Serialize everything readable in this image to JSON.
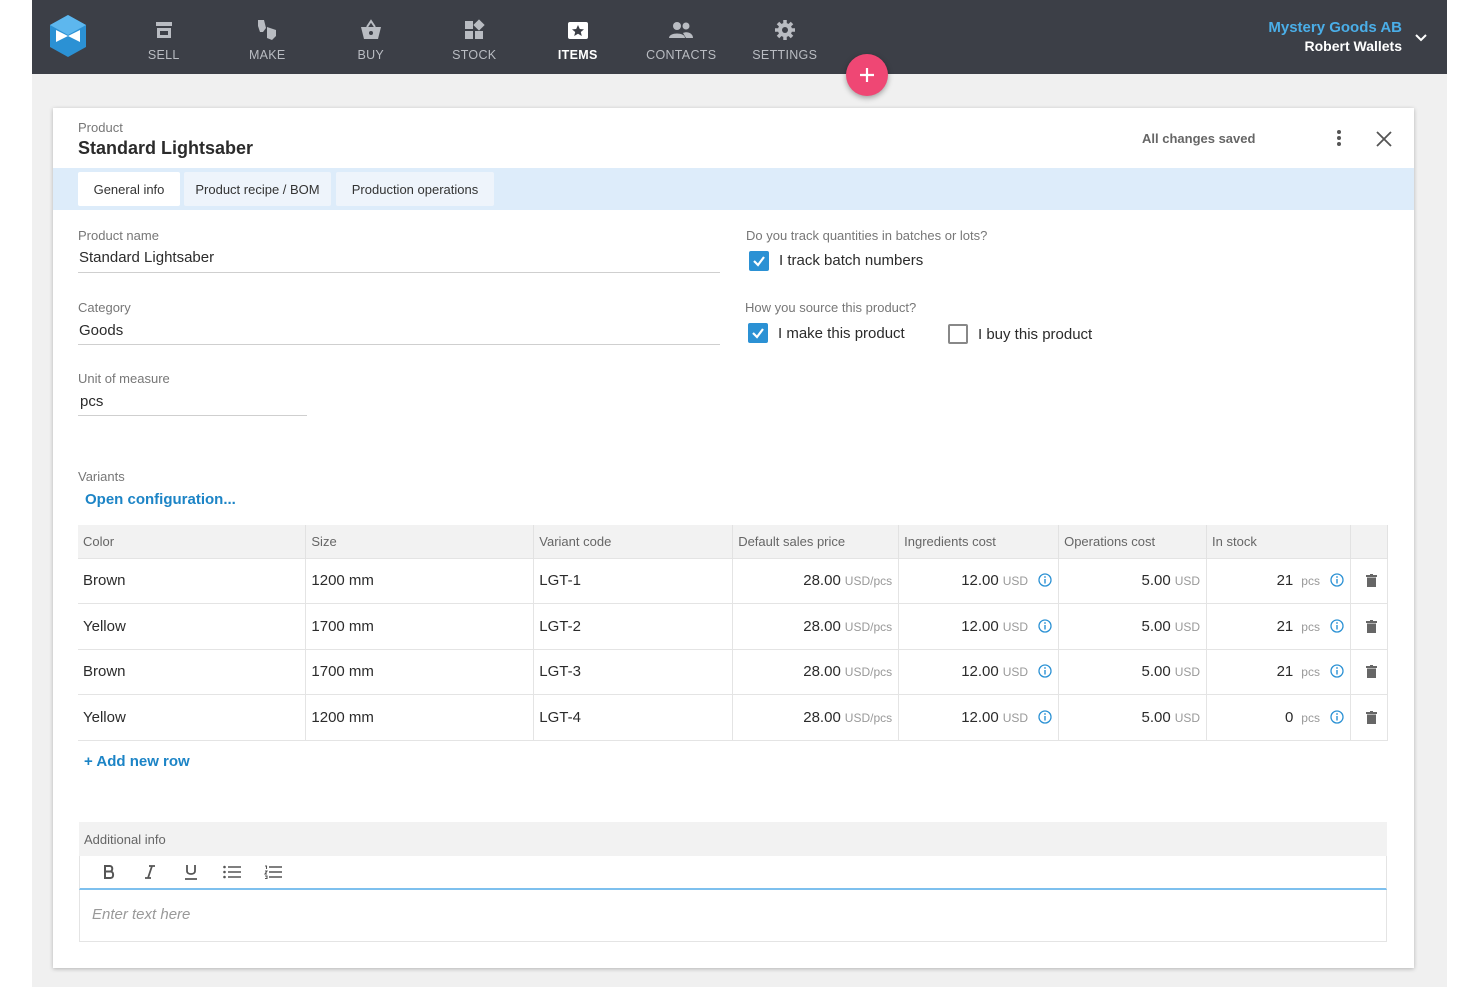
{
  "colors": {
    "topbar": "#3c3f47",
    "accent_blue": "#2b91d4",
    "company_name": "#4aaee8",
    "fab": "#ef4774",
    "tab_bar": "#ddecfa"
  },
  "nav": {
    "items": [
      {
        "label": "SELL",
        "icon": "store-icon"
      },
      {
        "label": "MAKE",
        "icon": "make-icon"
      },
      {
        "label": "BUY",
        "icon": "basket-icon"
      },
      {
        "label": "STOCK",
        "icon": "stock-icon"
      },
      {
        "label": "ITEMS",
        "icon": "items-icon",
        "active": true
      },
      {
        "label": "CONTACTS",
        "icon": "contacts-icon"
      },
      {
        "label": "SETTINGS",
        "icon": "gear-icon"
      }
    ],
    "company": "Mystery Goods AB",
    "user": "Robert Wallets"
  },
  "card": {
    "crumb": "Product",
    "title": "Standard Lightsaber",
    "status": "All changes saved"
  },
  "tabs": [
    "General info",
    "Product recipe / BOM",
    "Production operations"
  ],
  "form": {
    "product_name_label": "Product name",
    "product_name": "Standard Lightsaber",
    "category_label": "Category",
    "category": "Goods",
    "uom_label": "Unit of measure",
    "uom": "pcs",
    "batch_question": "Do you track quantities in batches or lots?",
    "batch_label": "I track batch numbers",
    "batch_checked": true,
    "source_question": "How you source this product?",
    "make_label": "I make this product",
    "make_checked": true,
    "buy_label": "I buy this product",
    "buy_checked": false
  },
  "variants": {
    "label": "Variants",
    "open_config": "Open configuration...",
    "columns": [
      "Color",
      "Size",
      "Variant code",
      "Default sales price",
      "Ingredients cost",
      "Operations cost",
      "In stock"
    ],
    "rows": [
      {
        "color": "Brown",
        "size": "1200 mm",
        "code": "LGT-1",
        "price": "28.00",
        "price_unit": "USD/pcs",
        "ingredients": "12.00",
        "ing_unit": "USD",
        "operations": "5.00",
        "ops_unit": "USD",
        "stock": "21",
        "stock_unit": "pcs"
      },
      {
        "color": "Yellow",
        "size": "1700 mm",
        "code": "LGT-2",
        "price": "28.00",
        "price_unit": "USD/pcs",
        "ingredients": "12.00",
        "ing_unit": "USD",
        "operations": "5.00",
        "ops_unit": "USD",
        "stock": "21",
        "stock_unit": "pcs"
      },
      {
        "color": "Brown",
        "size": "1700 mm",
        "code": "LGT-3",
        "price": "28.00",
        "price_unit": "USD/pcs",
        "ingredients": "12.00",
        "ing_unit": "USD",
        "operations": "5.00",
        "ops_unit": "USD",
        "stock": "21",
        "stock_unit": "pcs"
      },
      {
        "color": "Yellow",
        "size": "1200 mm",
        "code": "LGT-4",
        "price": "28.00",
        "price_unit": "USD/pcs",
        "ingredients": "12.00",
        "ing_unit": "USD",
        "operations": "5.00",
        "ops_unit": "USD",
        "stock": "0",
        "stock_unit": "pcs"
      }
    ],
    "add_row": "+ Add new row"
  },
  "additional_info": {
    "label": "Additional info",
    "placeholder": "Enter text here",
    "toolbar": [
      "bold-icon",
      "italic-icon",
      "underline-icon",
      "bullet-list-icon",
      "numbered-list-icon"
    ]
  }
}
